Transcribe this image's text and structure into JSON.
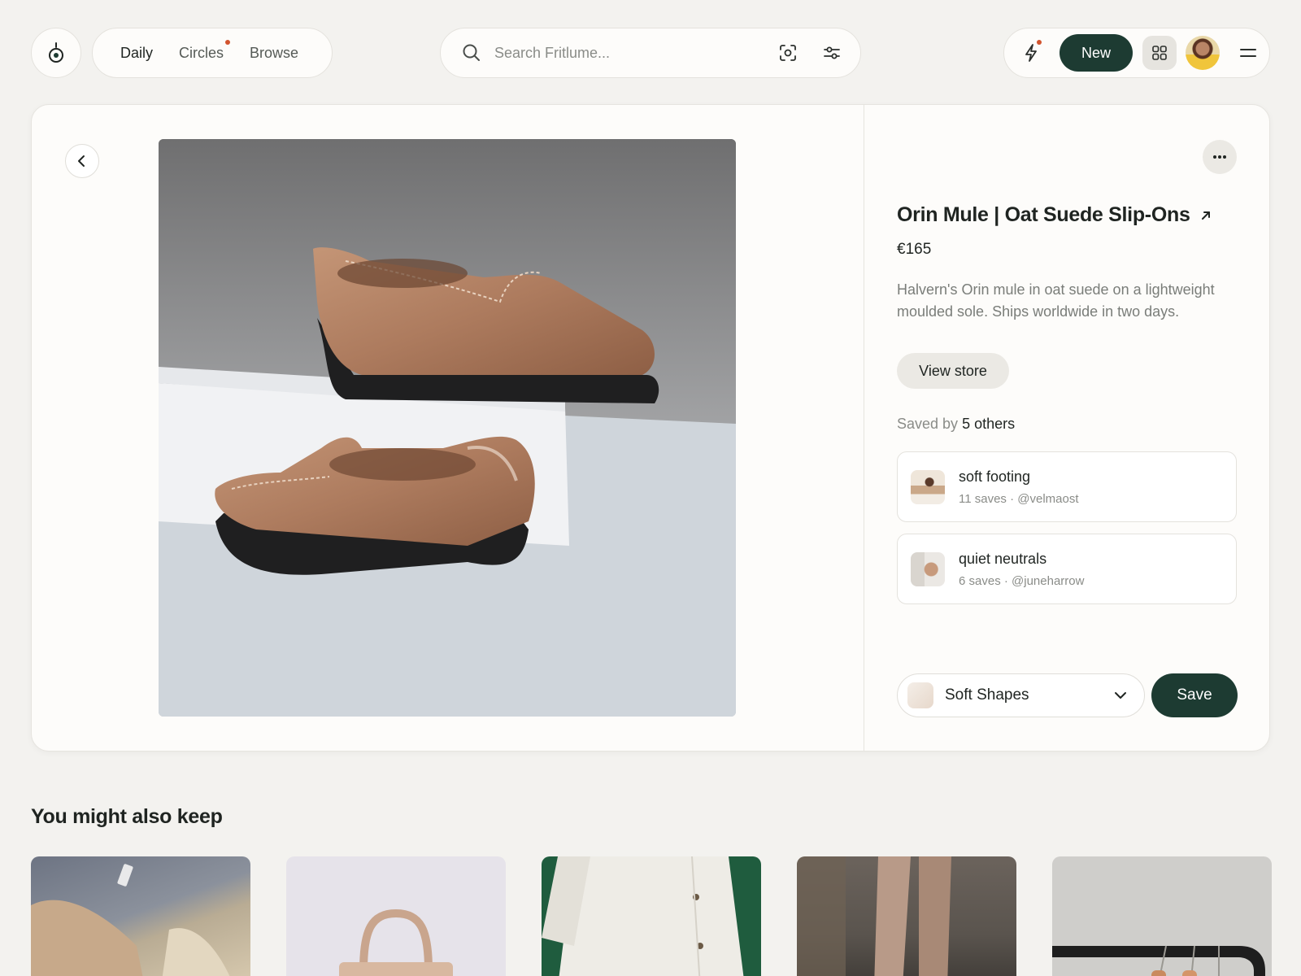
{
  "nav": {
    "tabs": [
      {
        "label": "Daily",
        "active": true
      },
      {
        "label": "Circles",
        "active": false,
        "has_notification": true
      },
      {
        "label": "Browse",
        "active": false
      }
    ]
  },
  "search": {
    "placeholder": "Search Fritlume...",
    "icons": [
      "search-icon",
      "visual-search-icon",
      "filter-icon"
    ]
  },
  "header_actions": {
    "new_label": "New",
    "icons": [
      "bolt-icon",
      "apps-grid-icon",
      "menu-icon"
    ]
  },
  "product": {
    "title": "Orin Mule | Oat Suede Slip-Ons",
    "price": "€165",
    "description": "Halvern's Orin mule in oat suede on a lightweight moulded sole. Ships worldwide in two days.",
    "view_store_label": "View store",
    "saved_by_prefix": "Saved by",
    "saved_by_count": "5 others"
  },
  "boards": [
    {
      "name": "soft footing",
      "meta": "11 saves · @velmaost"
    },
    {
      "name": "quiet neutrals",
      "meta": "6 saves · @juneharrow"
    }
  ],
  "save_bar": {
    "selected_board": "Soft Shapes",
    "save_label": "Save"
  },
  "recommendations": {
    "title": "You might also keep"
  },
  "colors": {
    "accent": "#1d3b32",
    "notification": "#d2542e",
    "background": "#f3f2ef",
    "card": "#fdfcfa"
  }
}
